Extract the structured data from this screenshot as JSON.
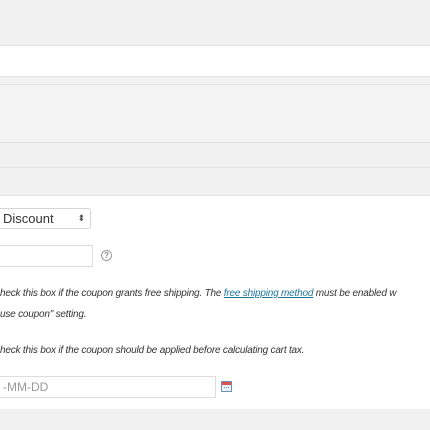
{
  "coupon": {
    "discount_type_value": "Discount",
    "select_arrows": "⬍",
    "help_glyph": "?",
    "free_shipping_description_prefix": "heck this box if the coupon grants free shipping. The ",
    "free_shipping_link": "free shipping method",
    "free_shipping_description_suffix": " must be enabled w",
    "free_shipping_description_line2": "use coupon\" setting.",
    "apply_before_tax_description": "heck this box if the coupon should be applied before calculating cart tax.",
    "expiry_date_placeholder": "-MM-DD"
  }
}
